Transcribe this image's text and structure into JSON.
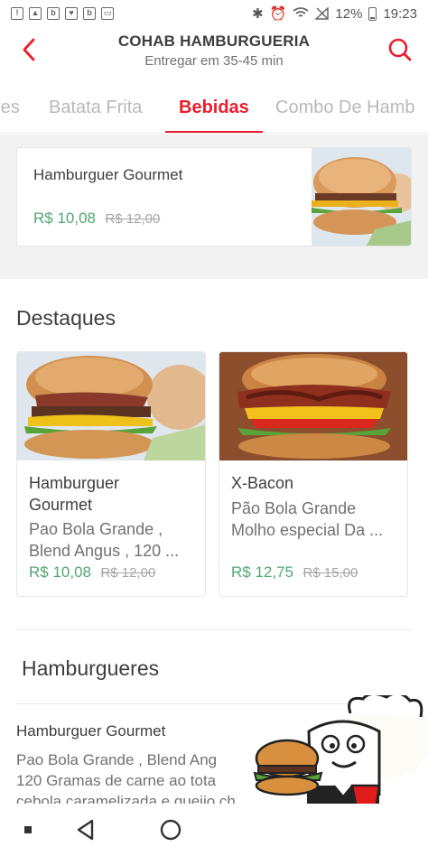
{
  "status_bar": {
    "battery": "12%",
    "time": "19:23"
  },
  "header": {
    "title": "COHAB HAMBURGUERIA",
    "subtitle": "Entregar em 35-45 min"
  },
  "tabs": [
    {
      "label": "res"
    },
    {
      "label": "Batata Frita"
    },
    {
      "label": "Bebidas"
    },
    {
      "label": "Combo De Hamb"
    }
  ],
  "promo": {
    "name": "Hamburguer Gourmet",
    "price": "R$ 10,08",
    "old_price": "R$ 12,00"
  },
  "destaques": {
    "title": "Destaques",
    "items": [
      {
        "name_line1": "Hamburguer",
        "name_line2": "Gourmet",
        "desc_line1": "Pao Bola Grande ,",
        "desc_line2": "Blend Angus , 120 ...",
        "price": "R$ 10,08",
        "old_price": "R$ 12,00"
      },
      {
        "name_line1": "X-Bacon",
        "desc_line1": "Pão Bola Grande",
        "desc_line2": "Molho especial Da ...",
        "price": "R$ 12,75",
        "old_price": "R$ 15,00"
      }
    ]
  },
  "hamburgueres": {
    "title": "Hamburgueres",
    "item": {
      "name": "Hamburguer Gourmet",
      "desc_line1": "Pao Bola Grande , Blend Ang",
      "desc_line2": "120 Gramas de carne ao tota",
      "desc_line3": "cebola caramelizada e queijo ch"
    }
  },
  "colors": {
    "accent": "#ea1d2c",
    "price_green": "#50a773",
    "text_dark": "#3e3e3e",
    "text_muted": "#717171"
  }
}
